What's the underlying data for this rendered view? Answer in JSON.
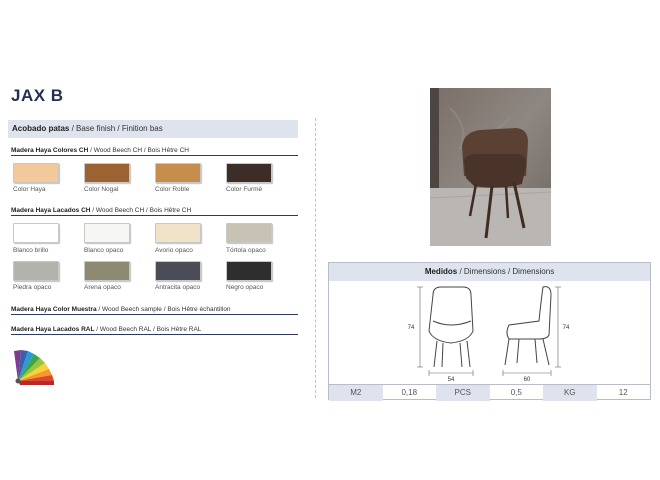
{
  "title": "JAX B",
  "base": {
    "bold": "Acobado patas",
    "rest": " / Base finish / Finition bas"
  },
  "sections": [
    {
      "bold": "Madera Haya Colores CH",
      "rest": " / Wood Beech CH / Bois Hêtre CH"
    },
    {
      "bold": "Madera Haya Lacados CH",
      "rest": " / Wood Beech CH / Bois Hêtre CH"
    },
    {
      "bold": "Madera Haya Color Muestra",
      "rest": " / Wood Beech sample / Bois Hêtre échantillon"
    },
    {
      "bold": "Madera Haya Lacados RAL",
      "rest": " / Wood Beech RAL / Bois Hêtre RAL"
    }
  ],
  "colors_ch": [
    {
      "label": "Color Haya",
      "color": "#f1c99a"
    },
    {
      "label": "Color Nogal",
      "color": "#9b6332"
    },
    {
      "label": "Color Roble",
      "color": "#c78d4d"
    },
    {
      "label": "Color Furmé",
      "color": "#3d2d28"
    }
  ],
  "lacados": [
    {
      "label": "Blanco brillo",
      "color": "#ffffff"
    },
    {
      "label": "Blanco opaco",
      "color": "#f6f6f4"
    },
    {
      "label": "Avorio opaco",
      "color": "#f1e3c9"
    },
    {
      "label": "Tórtola opaco",
      "color": "#c7c2b3"
    },
    {
      "label": "Piedra opaco",
      "color": "#b2b3ad"
    },
    {
      "label": "Arena opaco",
      "color": "#8c8a70"
    },
    {
      "label": "Antracita opaco",
      "color": "#4a4d55"
    },
    {
      "label": "Negro opaco",
      "color": "#2e2e2e"
    }
  ],
  "dims": {
    "title_bold": "Medidos",
    "title_rest": " / Dimensions / Dimensions",
    "front_height": "74",
    "front_width": "54",
    "side_height": "74",
    "side_depth": "60",
    "specs": [
      "M2",
      "0,18",
      "PCS",
      "0,5",
      "KG",
      "12"
    ]
  }
}
